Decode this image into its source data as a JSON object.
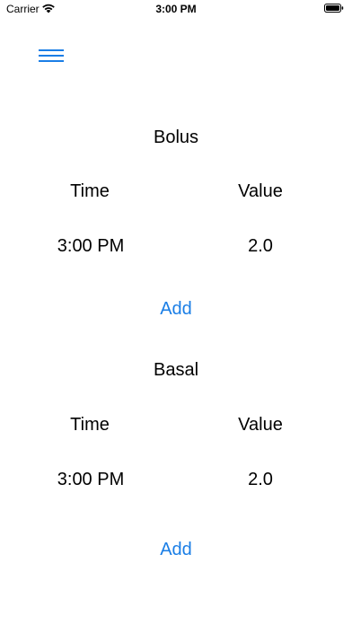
{
  "status_bar": {
    "carrier": "Carrier",
    "time": "3:00 PM",
    "icons": [
      "wifi-icon",
      "battery-icon"
    ]
  },
  "nav": {
    "menu_icon": "hamburger-menu-icon",
    "accent_color": "#1a7ee6"
  },
  "bolus": {
    "title": "Bolus",
    "columns": [
      "Time",
      "Value"
    ],
    "rows": [
      {
        "time": "3:00 PM",
        "value": "2.0"
      }
    ],
    "add_label": "Add"
  },
  "basal": {
    "title": "Basal",
    "columns": [
      "Time",
      "Value"
    ],
    "rows": [
      {
        "time": "3:00 PM",
        "value": "2.0"
      }
    ],
    "add_label": "Add"
  }
}
